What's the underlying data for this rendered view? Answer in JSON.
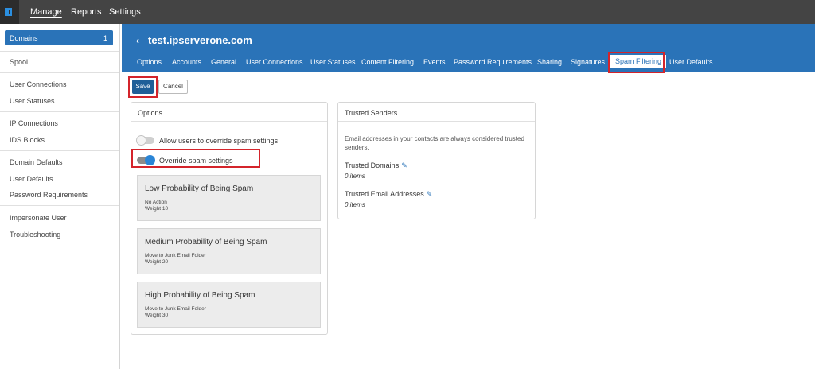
{
  "topbar": {
    "nav": [
      "Manage",
      "Reports",
      "Settings"
    ],
    "active": "Manage"
  },
  "sidebar": {
    "active_item": {
      "label": "Domains",
      "count": "1"
    },
    "items": [
      "Spool",
      "User Connections",
      "User Statuses",
      "IP Connections",
      "IDS Blocks",
      "Domain Defaults",
      "User Defaults",
      "Password Requirements",
      "Impersonate User",
      "Troubleshooting"
    ]
  },
  "header": {
    "back": "‹",
    "title": "test.ipserverone.com",
    "tabs": [
      "Options",
      "Accounts",
      "General",
      "User Connections",
      "User Statuses",
      "Content Filtering",
      "Events",
      "Password Requirements",
      "Sharing",
      "Signatures",
      "Spam Filtering",
      "User Defaults"
    ],
    "active_tab": "Spam Filtering"
  },
  "toolbar": {
    "save_label": "Save",
    "cancel_label": "Cancel"
  },
  "options_panel": {
    "title": "Options",
    "toggle_override_users": {
      "label": "Allow users to override spam settings",
      "on": false
    },
    "toggle_override_spam": {
      "label": "Override spam settings",
      "on": true
    },
    "levels": [
      {
        "title": "Low Probability of Being Spam",
        "action": "No Action",
        "weight": "Weight 10"
      },
      {
        "title": "Medium Probability of Being Spam",
        "action": "Move to Junk Email Folder",
        "weight": "Weight 20"
      },
      {
        "title": "High Probability of Being Spam",
        "action": "Move to Junk Email Folder",
        "weight": "Weight 30"
      }
    ]
  },
  "trusted_panel": {
    "title": "Trusted Senders",
    "description": "Email addresses in your contacts are always considered trusted senders.",
    "domains_label": "Trusted Domains",
    "domains_count": "0 items",
    "emails_label": "Trusted Email Addresses",
    "emails_count": "0 items"
  },
  "colors": {
    "accent": "#2a73b8",
    "topbar": "#444444",
    "highlight": "#d4242b"
  }
}
